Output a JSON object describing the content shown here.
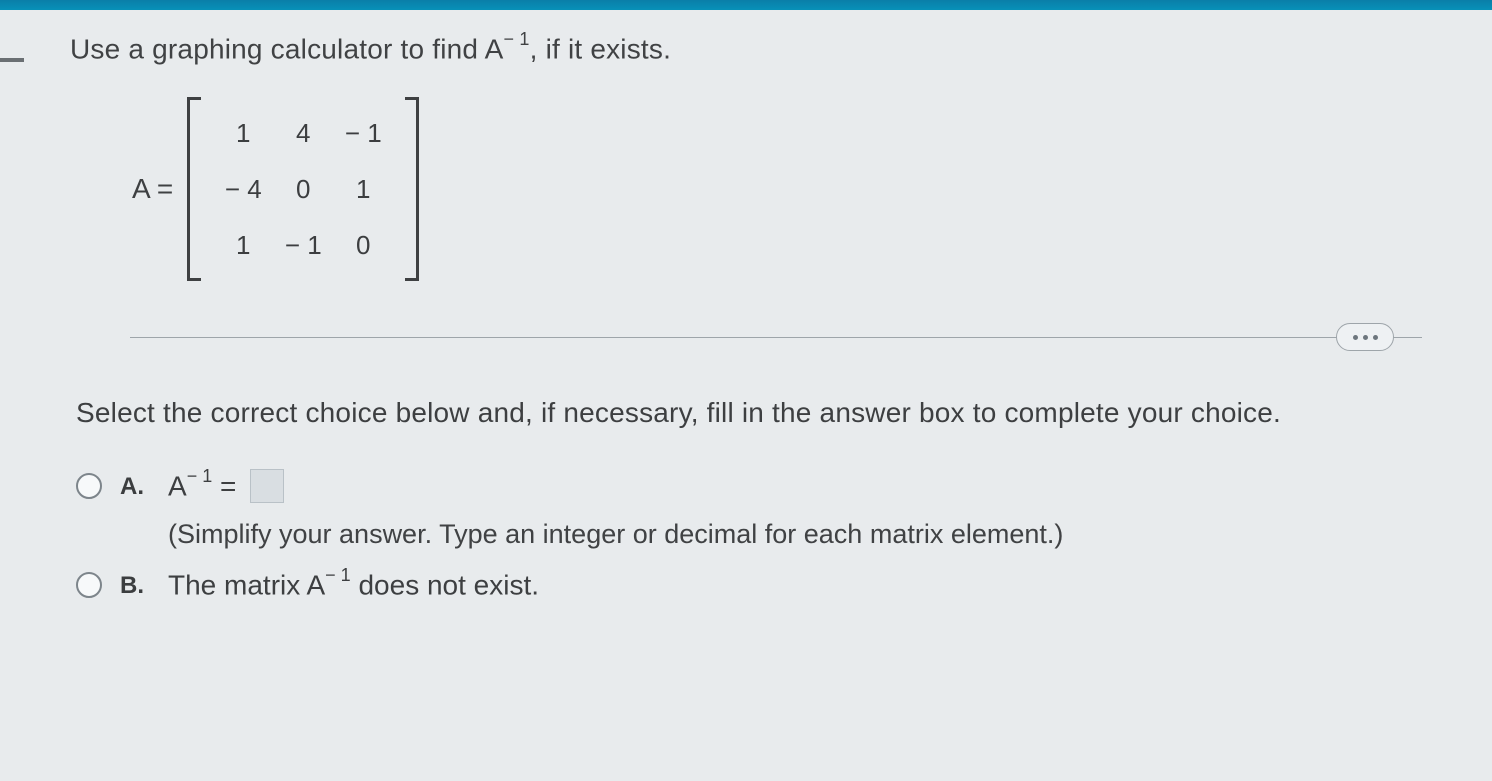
{
  "question": {
    "prefix": "Use a graphing calculator to find A",
    "exponent": "− 1",
    "suffix": ", if it exists."
  },
  "matrix": {
    "label": "A =",
    "rows": [
      [
        "1",
        "4",
        "− 1"
      ],
      [
        "− 4",
        "0",
        "1"
      ],
      [
        "1",
        "− 1",
        "0"
      ]
    ]
  },
  "prompt": "Select the correct choice below and, if necessary, fill in the answer box to complete your choice.",
  "choices": {
    "a": {
      "letter": "A.",
      "expr_prefix": "A",
      "expr_exp": "− 1",
      "expr_eq": " = ",
      "hint": "(Simplify your answer. Type an integer or decimal for each matrix element.)"
    },
    "b": {
      "letter": "B.",
      "text_prefix": "The matrix A",
      "text_exp": "− 1",
      "text_suffix": " does not exist."
    }
  }
}
